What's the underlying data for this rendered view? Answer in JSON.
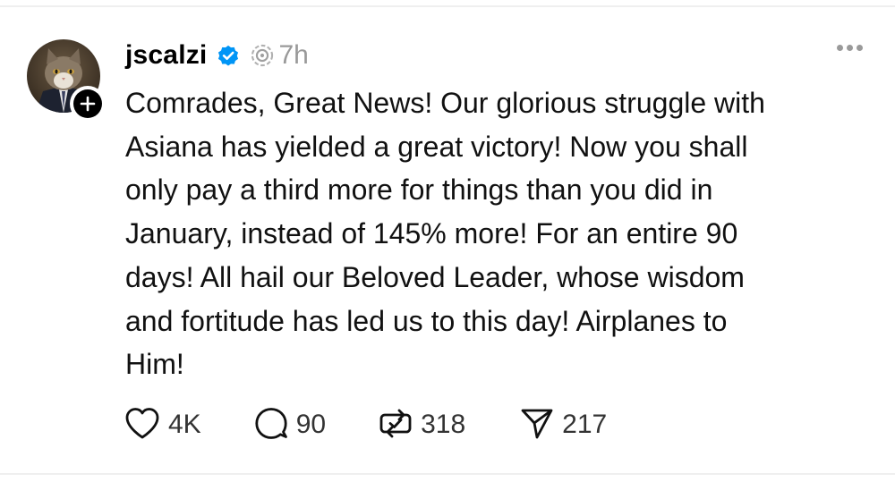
{
  "post": {
    "username": "jscalzi",
    "timestamp": "7h",
    "text": "Comrades, Great News! Our glorious struggle with\nAsiana has yielded a great victory! Now you shall\nonly pay a third more for things than you did in\nJanuary, instead of 145% more! For an entire 90\ndays! All hail our Beloved Leader, whose wisdom\nand fortitude has led us to this day! Airplanes to\nHim!",
    "icons": {
      "verified": "verified-badge-icon",
      "threads": "threads-icon",
      "more": "more-options-icon",
      "follow": "plus-icon"
    },
    "colors": {
      "verified": "#0095f6",
      "muted": "#999999",
      "text": "#111111"
    }
  },
  "actions": {
    "likes": "4K",
    "replies": "90",
    "reposts": "318",
    "shares": "217"
  }
}
